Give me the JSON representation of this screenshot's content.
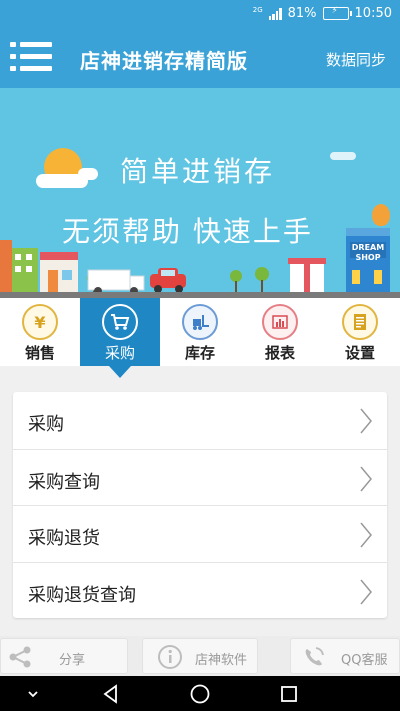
{
  "status_bar": {
    "network": "2G",
    "battery": "81%",
    "time": "10:50"
  },
  "app_bar": {
    "title": "店神进销存精简版",
    "sync_label": "数据同步"
  },
  "banner": {
    "title": "简单进销存",
    "subtitle": "无须帮助  快速上手",
    "shop_sign_line1": "DREAM",
    "shop_sign_line2": "SHOP"
  },
  "tabs": [
    {
      "label": "销售",
      "icon": "yen-icon",
      "glyph": "¥",
      "color": "#d7a21e"
    },
    {
      "label": "采购",
      "icon": "shopping-cart-icon",
      "glyph": "",
      "color": "#ffffff",
      "active": true
    },
    {
      "label": "库存",
      "icon": "forklift-icon",
      "glyph": "",
      "color": "#3f7fc9"
    },
    {
      "label": "报表",
      "icon": "bar-chart-icon",
      "glyph": "",
      "color": "#d94c54"
    },
    {
      "label": "设置",
      "icon": "document-icon",
      "glyph": "",
      "color": "#d7a21e"
    }
  ],
  "menu_items": [
    {
      "label": "采购"
    },
    {
      "label": "采购查询"
    },
    {
      "label": "采购退货"
    },
    {
      "label": "采购退货查询"
    }
  ],
  "bottom_toolbar": {
    "share": "分享",
    "software": "店神软件",
    "qq_service": "QQ客服"
  },
  "colors": {
    "primary": "#3aa2d6",
    "active_tab": "#1e87c4",
    "banner": "#60c4e3"
  }
}
